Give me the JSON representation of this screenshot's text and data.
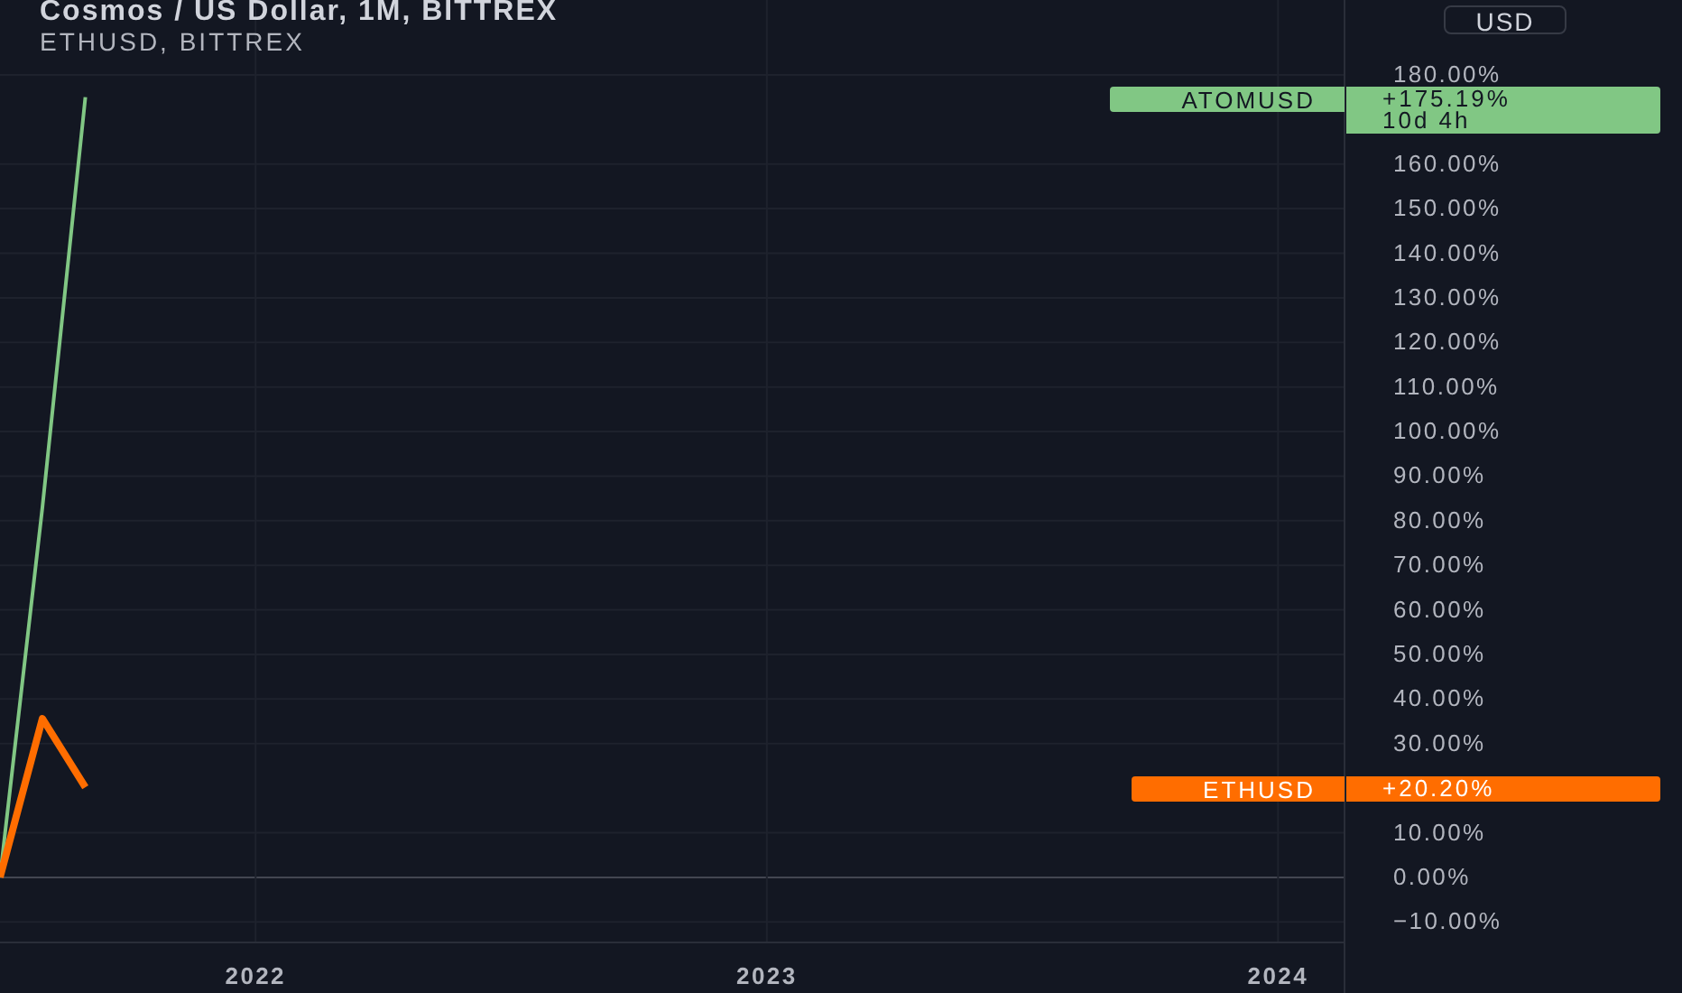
{
  "header": {
    "title": "Cosmos / US Dollar, 1M, BITTREX",
    "subtitle": "ETHUSD, BITTREX"
  },
  "currency_button": "USD",
  "chart_data": {
    "type": "line",
    "grid": true,
    "x": [
      2021.5,
      2021.583,
      2021.667
    ],
    "series": [
      {
        "name": "ATOMUSD",
        "color": "#81c784",
        "values": [
          0,
          83,
          175
        ]
      },
      {
        "name": "ETHUSD",
        "color": "#ff6d00",
        "values": [
          0,
          35.6,
          20.2
        ]
      }
    ],
    "xlim": [
      2021.5,
      2024.13
    ],
    "ylim": [
      -14.6,
      196.8
    ],
    "xticks": [
      {
        "value": 2022,
        "label": "2022"
      },
      {
        "value": 2023,
        "label": "2023"
      },
      {
        "value": 2024,
        "label": "2024"
      }
    ],
    "yticks": [
      {
        "value": -10,
        "label": "−10.00%"
      },
      {
        "value": 0,
        "label": "0.00%"
      },
      {
        "value": 10,
        "label": "10.00%"
      },
      {
        "value": 30,
        "label": "30.00%"
      },
      {
        "value": 40,
        "label": "40.00%"
      },
      {
        "value": 50,
        "label": "50.00%"
      },
      {
        "value": 60,
        "label": "60.00%"
      },
      {
        "value": 70,
        "label": "70.00%"
      },
      {
        "value": 80,
        "label": "80.00%"
      },
      {
        "value": 90,
        "label": "90.00%"
      },
      {
        "value": 100,
        "label": "100.00%"
      },
      {
        "value": 110,
        "label": "110.00%"
      },
      {
        "value": 120,
        "label": "120.00%"
      },
      {
        "value": 130,
        "label": "130.00%"
      },
      {
        "value": 140,
        "label": "140.00%"
      },
      {
        "value": 150,
        "label": "150.00%"
      },
      {
        "value": 160,
        "label": "160.00%"
      },
      {
        "value": 180,
        "label": "180.00%"
      }
    ]
  },
  "price_labels": [
    {
      "value": "+175.19%",
      "countdown": "10d 4h"
    },
    {
      "value": "+20.20%"
    }
  ]
}
